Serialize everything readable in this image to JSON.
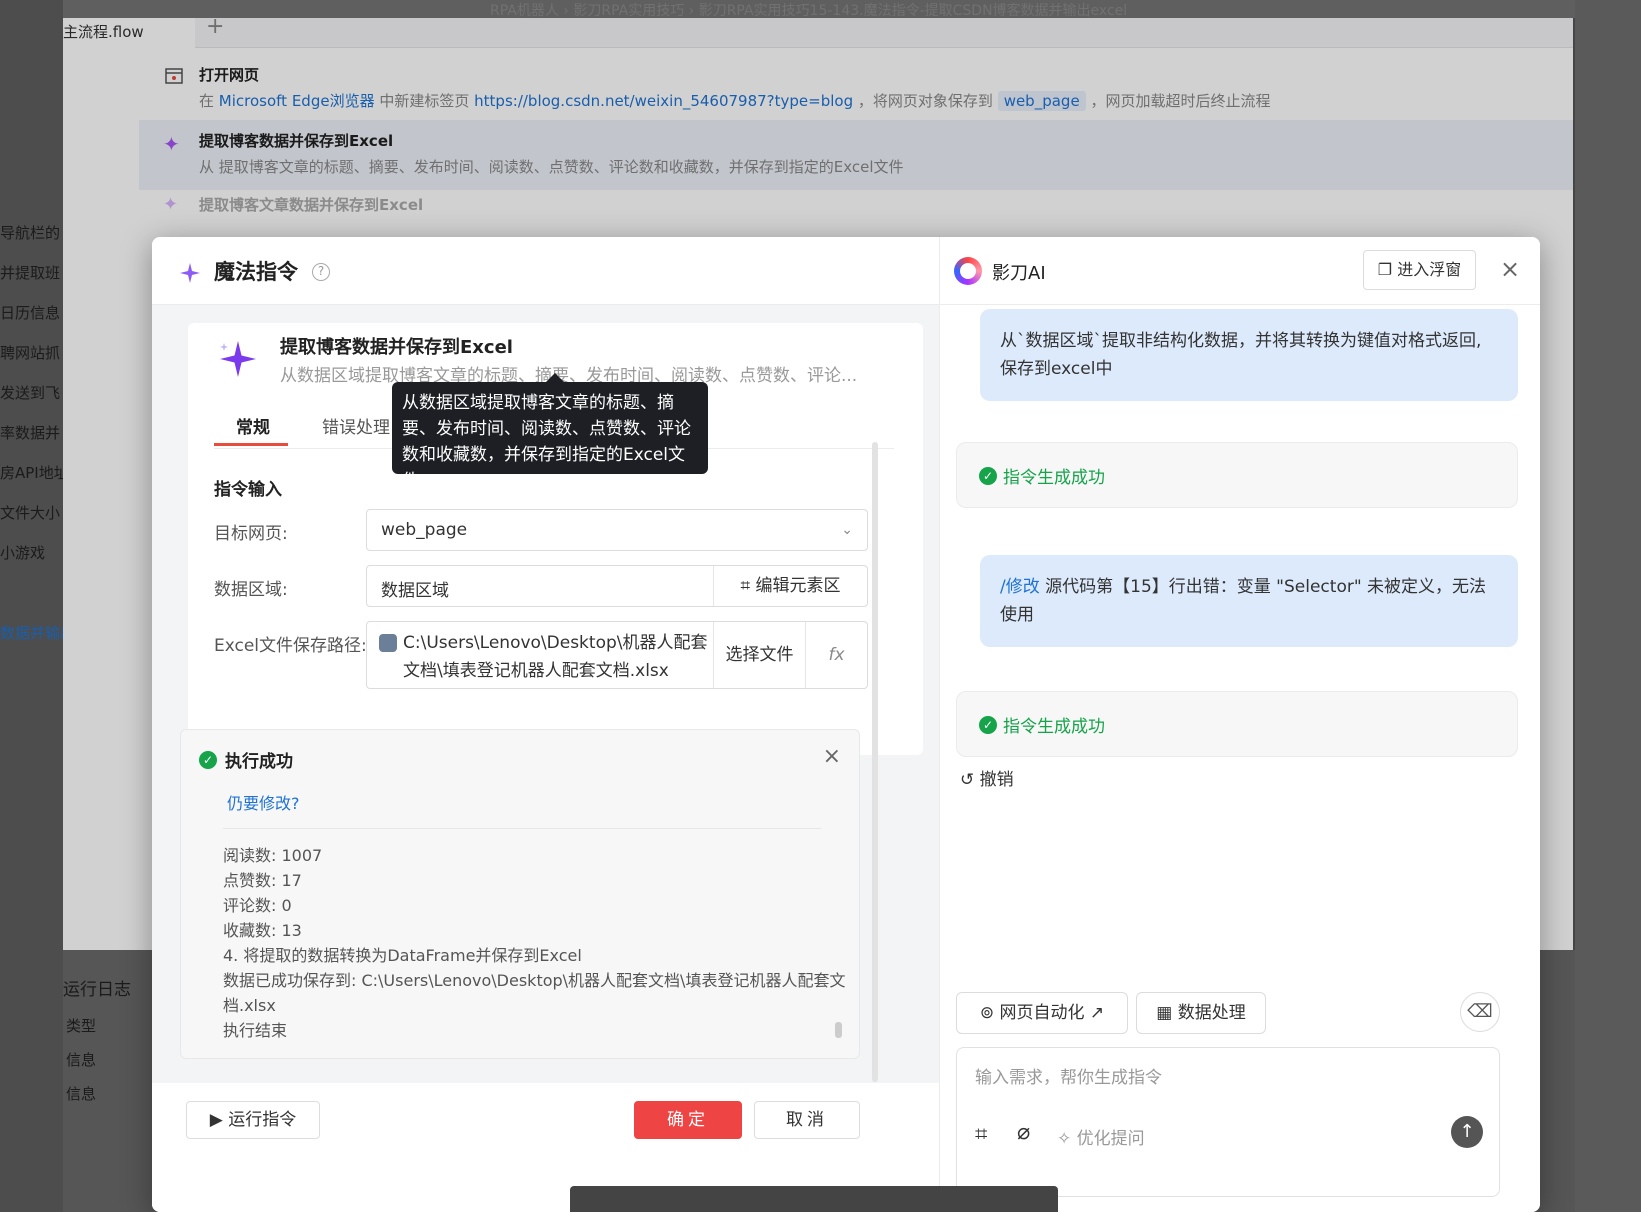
{
  "breadcrumb": "RPA机器人 › 影刀RPA实用技巧 › 影刀RPA实用技巧15-143.魔法指令-提取CSDN博客数据并输出excel",
  "editor": {
    "tab_label": "主流程.flow",
    "tab_add": "+",
    "left_nav": [
      "导航栏的",
      "并提取班",
      "日历信息",
      "聘网站抓",
      "发送到飞",
      "率数据并",
      "房API地址",
      "文件大小",
      "小游戏",
      "数据并输出"
    ],
    "steps": [
      {
        "title": "打开网页",
        "desc_prefix": "在",
        "browser": "Microsoft Edge浏览器",
        "desc_mid": "中新建标签页",
        "url": "https://blog.csdn.net/weixin_54607987?type=blog",
        "desc_mid2": "，将网页对象保存到",
        "var": "web_page",
        "desc_suffix": "，网页加载超时后终止流程"
      },
      {
        "title": "提取博客数据并保存到Excel",
        "desc": "从 提取博客文章的标题、摘要、发布时间、阅读数、点赞数、评论数和收藏数，并保存到指定的Excel文件"
      },
      {
        "title": "提取博客文章数据并保存到Excel",
        "desc": ""
      }
    ],
    "log_title": "运行日志",
    "log_header": "类型",
    "log_rows": [
      "信息",
      "信息"
    ]
  },
  "magic": {
    "title": "魔法指令",
    "help": "?",
    "command_title": "提取博客数据并保存到Excel",
    "command_desc": "从数据区域提取博客文章的标题、摘要、发布时间、阅读数、点赞数、评论...",
    "tabs": [
      "常规",
      "错误处理"
    ],
    "tooltip": "从数据区域提取博客文章的标题、摘要、发布时间、阅读数、点赞数、评论数和收藏数，并保存到指定的Excel文件",
    "section": "指令输入",
    "fields": {
      "target_label": "目标网页:",
      "target_value": "web_page",
      "area_label": "数据区域:",
      "area_value": "数据区域",
      "area_btn": "编辑元素区",
      "path_label": "Excel文件保存路径:",
      "path_value": "C:\\Users\\Lenovo\\Desktop\\机器人配套文档\\填表登记机器人配套文档.xlsx",
      "choose_btn": "选择文件",
      "fx": "fx"
    },
    "result": {
      "title": "执行成功",
      "still_modify": "仍要修改?",
      "lines": [
        "  阅读数: 1007",
        "  点赞数: 17",
        "  评论数: 0",
        "  收藏数: 13",
        "4. 将提取的数据转换为DataFrame并保存到Excel",
        "  数据已成功保存到: C:\\Users\\Lenovo\\Desktop\\机器人配套文档\\填表登记机器人配套文",
        "档.xlsx",
        "执行结束"
      ]
    },
    "footer": {
      "run": "运行指令",
      "ok": "确定",
      "cancel": "取消"
    }
  },
  "ai": {
    "title": "影刀AI",
    "float_btn": "进入浮窗",
    "messages": [
      {
        "type": "user",
        "text": "从`数据区域`提取非结构化数据，并将其转换为键值对格式返回,保存到excel中"
      },
      {
        "type": "ok",
        "text": "指令生成成功"
      },
      {
        "type": "user",
        "cmd": "/修改",
        "text": "源代码第【15】行出错：变量 \"Selector\" 未被定义，无法使用"
      },
      {
        "type": "ok",
        "text": "指令生成成功"
      }
    ],
    "undo": "撤销",
    "chips": [
      "网页自动化",
      "数据处理"
    ],
    "input_placeholder": "输入需求，帮你生成指令",
    "optimize": "优化提问"
  },
  "colors": {
    "accent_red": "#ef4444",
    "success": "#16a34a",
    "link": "#1f73d4"
  }
}
